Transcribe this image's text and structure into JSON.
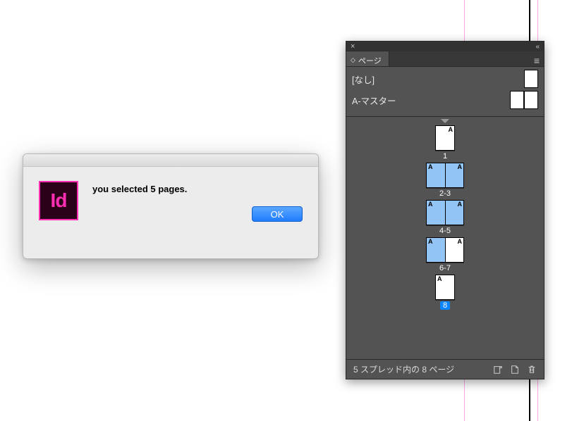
{
  "dialog": {
    "app_icon_text": "Id",
    "message": "you selected  5  pages.",
    "ok_label": "OK"
  },
  "panel": {
    "tab_label": "ページ",
    "masters": [
      {
        "label": "[なし]",
        "spread": false
      },
      {
        "label": "A-マスター",
        "spread": true
      }
    ],
    "spreads": [
      {
        "label": "1",
        "pages": [
          {
            "master": "A",
            "side": "right",
            "selected": false
          }
        ]
      },
      {
        "label": "2-3",
        "pages": [
          {
            "master": "A",
            "side": "left",
            "selected": true
          },
          {
            "master": "A",
            "side": "right",
            "selected": true
          }
        ]
      },
      {
        "label": "4-5",
        "pages": [
          {
            "master": "A",
            "side": "left",
            "selected": true
          },
          {
            "master": "A",
            "side": "right",
            "selected": true
          }
        ]
      },
      {
        "label": "6-7",
        "pages": [
          {
            "master": "A",
            "side": "left",
            "selected": true
          },
          {
            "master": "A",
            "side": "right",
            "selected": false
          }
        ]
      },
      {
        "label": "8",
        "pages": [
          {
            "master": "A",
            "side": "left",
            "selected": false
          }
        ],
        "label_selected": true
      }
    ],
    "footer_text": "5 スプレッド内の 8 ページ"
  }
}
